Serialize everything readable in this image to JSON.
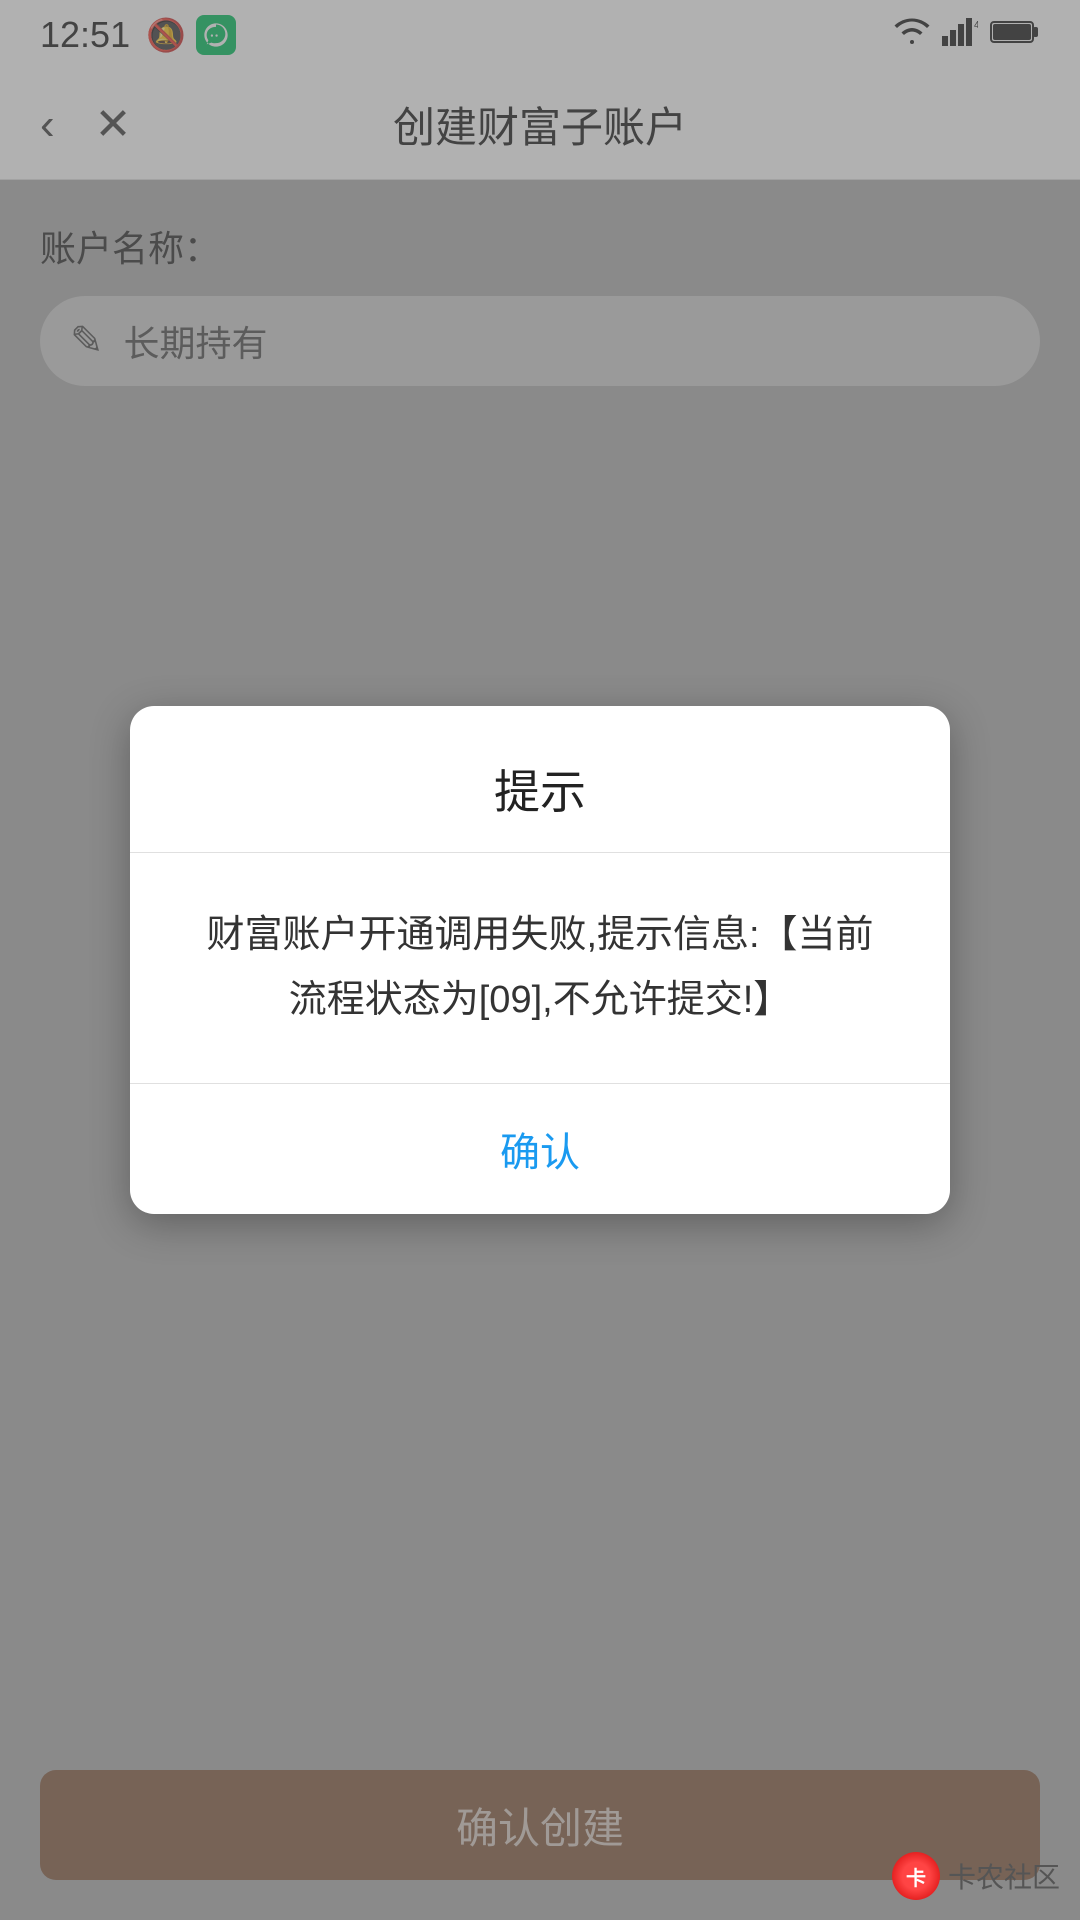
{
  "statusBar": {
    "time": "12:51",
    "bellIcon": "🔔",
    "wifiIcon": "wifi",
    "signalLabel": "4G",
    "batteryIcon": "battery"
  },
  "navBar": {
    "backLabel": "‹",
    "closeLabel": "×",
    "title": "创建财富子账户"
  },
  "form": {
    "accountLabel": "账户名称：",
    "accountPlaceholder": "长期持有",
    "editIconLabel": "✎"
  },
  "modal": {
    "title": "提示",
    "message": "财富账户开通调用失败,提示信息:【当前流程状态为[09],不允许提交!】",
    "confirmLabel": "确认"
  },
  "bottomButton": {
    "label": "确认创建"
  },
  "watermark": {
    "logoText": "卡",
    "text": "卡农社区"
  }
}
